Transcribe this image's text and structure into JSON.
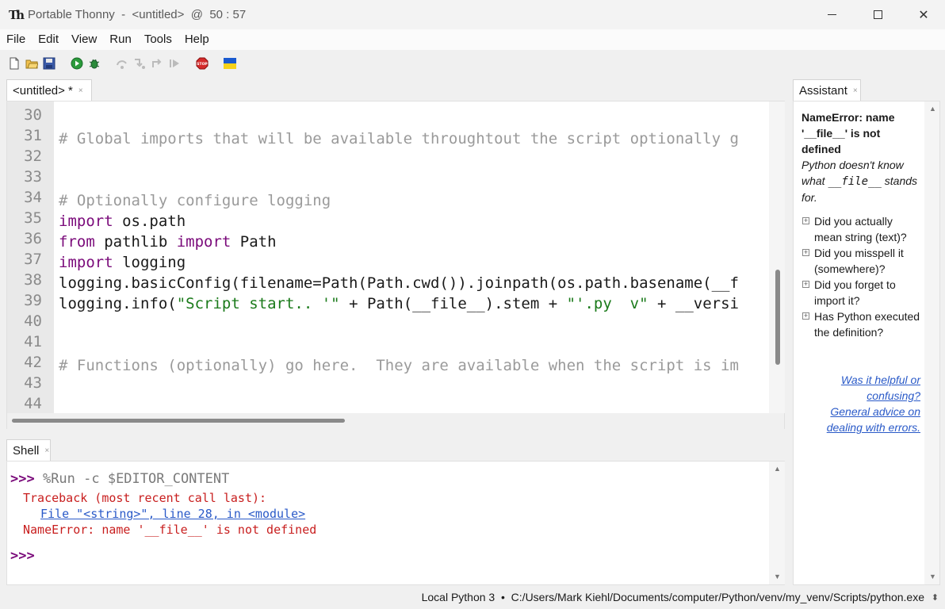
{
  "window": {
    "app_name": "Portable Thonny",
    "separator": "-",
    "file": "<untitled>",
    "at": "@",
    "cursor": "50 : 57"
  },
  "menu": [
    "File",
    "Edit",
    "View",
    "Run",
    "Tools",
    "Help"
  ],
  "toolbar_icons": [
    "new-file-icon",
    "open-file-icon",
    "save-icon",
    "run-icon",
    "debug-icon",
    "step-over-icon",
    "step-into-icon",
    "step-out-icon",
    "resume-icon",
    "stop-icon",
    "ukraine-flag-icon"
  ],
  "editor_tab": {
    "label": "<untitled> *",
    "close": "×"
  },
  "editor": {
    "line_numbers": [
      "30",
      "31",
      "32",
      "33",
      "34",
      "35",
      "36",
      "37",
      "38",
      "39",
      "40",
      "41",
      "42",
      "43",
      "44"
    ],
    "lines": [
      {
        "num": "31",
        "cm": "# Global imports that will be available throughtout the script optionally g"
      },
      {
        "num": "34",
        "cm": "# Optionally configure logging"
      },
      {
        "num": "35",
        "kw": "import",
        "rest": " os.path"
      },
      {
        "num": "36",
        "kw": "from",
        "mid": " pathlib ",
        "kw2": "import",
        "rest": " Path"
      },
      {
        "num": "37",
        "kw": "import",
        "rest": " logging"
      },
      {
        "num": "38",
        "plain": "logging.basicConfig(filename=Path(Path.cwd()).joinpath(os.path.basename(__f"
      },
      {
        "num": "39",
        "p1": "logging.info(",
        "s1": "\"Script start.. '\"",
        "p2": " + Path(__file__).stem + ",
        "s2": "\"'.py  v\"",
        "p3": " + __versi"
      },
      {
        "num": "42",
        "cm": "# Functions (optionally) go here.  They are available when the script is im"
      }
    ]
  },
  "shell_tab": {
    "label": "Shell",
    "close": "×"
  },
  "shell": {
    "prompt": ">>>",
    "command": " %Run -c $EDITOR_CONTENT",
    "traceback": "Traceback (most recent call last):",
    "file_link": "File \"<string>\", line 28, in <module>",
    "error": "NameError: name '__file__' is not defined",
    "prompt2": ">>>"
  },
  "assistant_tab": {
    "label": "Assistant",
    "close": "×"
  },
  "assistant": {
    "title": "NameError: name '__file__' is not defined",
    "subtitle_pre": "Python doesn't know what ",
    "subtitle_mono": "__file__",
    "subtitle_post": " stands for.",
    "hints": [
      "Did you actually mean string (text)?",
      "Did you misspell it (somewhere)?",
      "Did you forget to import it?",
      "Has Python executed the definition?"
    ],
    "hint_marker": "⊞",
    "link1": "Was it helpful or confusing?",
    "link2": "General advice on dealing with errors."
  },
  "status": {
    "text": "Local Python 3  •  C:/Users/Mark Kiehl/Documents/computer/Python/venv/my_venv/Scripts/python.exe"
  },
  "colors": {
    "keyword": "#7a0a7a",
    "comment": "#9a9a9a",
    "string": "#1a7a1a",
    "error": "#c81e1e",
    "link": "#2a5ac8"
  }
}
